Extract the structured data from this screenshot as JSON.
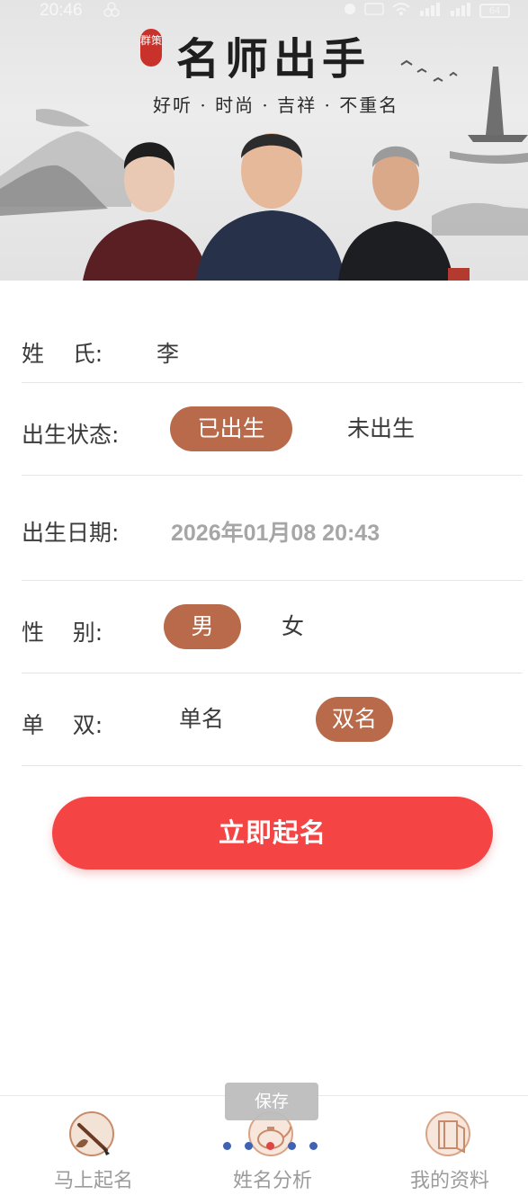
{
  "status_bar": {
    "time": "20:46",
    "battery": "64"
  },
  "banner": {
    "seal": "群策",
    "title": "名师出手",
    "subtitle": "好听 · 时尚 · 吉祥 · 不重名"
  },
  "form": {
    "surname": {
      "label": "姓    氏:",
      "value": "李"
    },
    "birth_status": {
      "label": "出生状态:",
      "options": [
        "已出生",
        "未出生"
      ],
      "selected": "已出生"
    },
    "birth_date": {
      "label": "出生日期:",
      "value": "2026年01月08 20:43"
    },
    "gender": {
      "label": "性    别:",
      "options": [
        "男",
        "女"
      ],
      "selected": "男"
    },
    "name_length": {
      "label": "单    双:",
      "options": [
        "单名",
        "双名"
      ],
      "selected": "双名"
    }
  },
  "submit_label": "立即起名",
  "toast": "保存",
  "tabs": [
    {
      "label": "马上起名",
      "icon": "brush-icon"
    },
    {
      "label": "姓名分析",
      "icon": "teapot-icon"
    },
    {
      "label": "我的资料",
      "icon": "book-icon"
    }
  ],
  "colors": {
    "accent": "#b86a4a",
    "primary_button": "#f54444",
    "tab_label": "#9b9b9b"
  }
}
